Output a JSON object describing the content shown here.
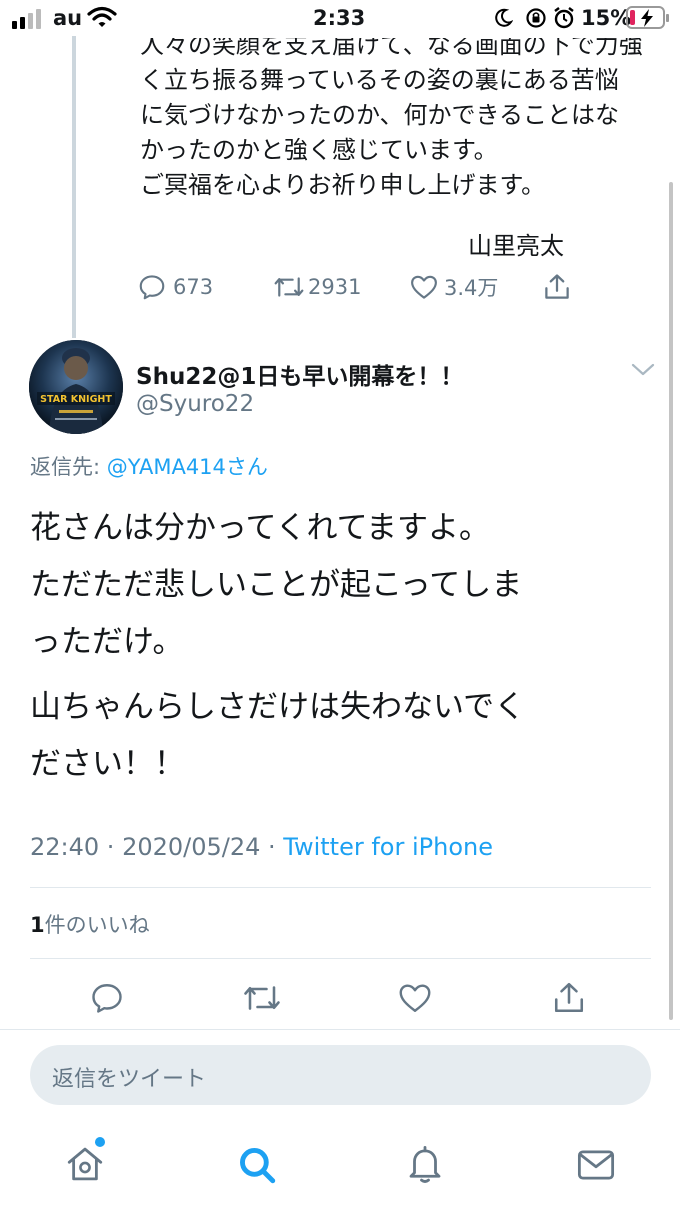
{
  "status_bar": {
    "carrier": "au",
    "time": "2:33",
    "battery": "15%"
  },
  "parent_tweet": {
    "lines": [
      "人々の笑顔を支え届けて、なる画面の下で力強",
      "く立ち振る舞っているその姿の裏にある苦悩",
      "に気づけなかったのか、何かできることはな",
      "かったのかと強く感じています。",
      "ご冥福を心よりお祈り申し上げます。"
    ],
    "signature": "山里亮太",
    "replies": "673",
    "retweets": "2931",
    "likes": "3.4万"
  },
  "tweet": {
    "author_name": "Shu22@1日も早い開幕を！！",
    "author_handle": "@Syuro22",
    "reply_prefix": "返信先: ",
    "reply_mention": "@YAMA414さん",
    "body_lines": [
      "花さんは分かってくれてますよ。",
      "ただただ悲しいことが起こってしま",
      "っただけ。",
      "山ちゃんらしさだけは失わないでく",
      "ださい！！"
    ],
    "time": "22:40",
    "date": "2020/05/24",
    "separator": " · ",
    "source": "Twitter for iPhone",
    "like_count": "1",
    "like_label": "件のいいね",
    "avatar_caption": "STAR KNIGHT"
  },
  "reply_bar": {
    "placeholder": "返信をツイート"
  },
  "colors": {
    "accent": "#1da1f2",
    "muted": "#657786",
    "divider": "#e1e8ed",
    "battery_low": "#e0245e"
  },
  "icons": [
    "signal-icon",
    "wifi-icon",
    "moon-icon",
    "lock-rotation-icon",
    "alarm-icon",
    "battery-icon",
    "reply-icon",
    "retweet-icon",
    "like-icon",
    "share-icon",
    "chevron-down-icon",
    "home-icon",
    "search-icon",
    "bell-icon",
    "mail-icon"
  ]
}
